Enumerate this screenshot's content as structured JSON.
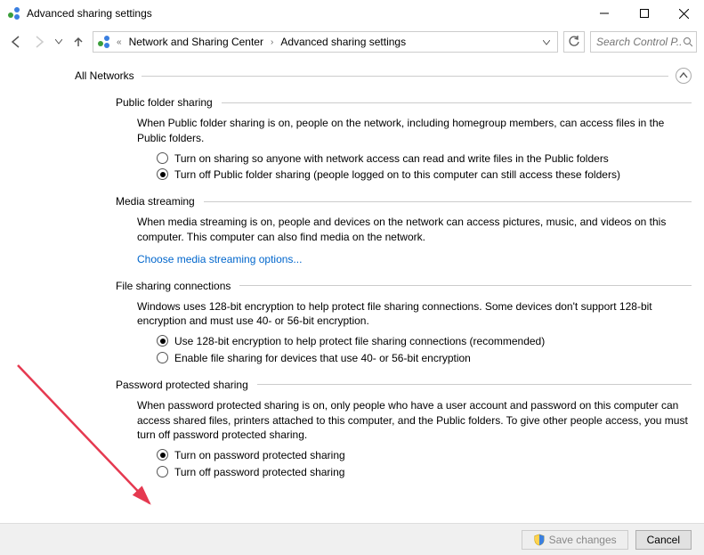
{
  "window": {
    "title": "Advanced sharing settings"
  },
  "search": {
    "placeholder": "Search Control P..."
  },
  "breadcrumb": {
    "parent": "Network and Sharing Center",
    "current": "Advanced sharing settings"
  },
  "section": {
    "title": "All Networks"
  },
  "groups": {
    "public_folder": {
      "title": "Public folder sharing",
      "desc": "When Public folder sharing is on, people on the network, including homegroup members, can access files in the Public folders.",
      "opt_on": "Turn on sharing so anyone with network access can read and write files in the Public folders",
      "opt_off": "Turn off Public folder sharing (people logged on to this computer can still access these folders)"
    },
    "media": {
      "title": "Media streaming",
      "desc": "When media streaming is on, people and devices on the network can access pictures, music, and videos on this computer. This computer can also find media on the network.",
      "link": "Choose media streaming options..."
    },
    "encryption": {
      "title": "File sharing connections",
      "desc": "Windows uses 128-bit encryption to help protect file sharing connections. Some devices don't support 128-bit encryption and must use 40- or 56-bit encryption.",
      "opt_128": "Use 128-bit encryption to help protect file sharing connections (recommended)",
      "opt_40": "Enable file sharing for devices that use 40- or 56-bit encryption"
    },
    "password": {
      "title": "Password protected sharing",
      "desc": "When password protected sharing is on, only people who have a user account and password on this computer can access shared files, printers attached to this computer, and the Public folders. To give other people access, you must turn off password protected sharing.",
      "opt_on": "Turn on password protected sharing",
      "opt_off": "Turn off password protected sharing"
    }
  },
  "footer": {
    "save": "Save changes",
    "cancel": "Cancel"
  }
}
